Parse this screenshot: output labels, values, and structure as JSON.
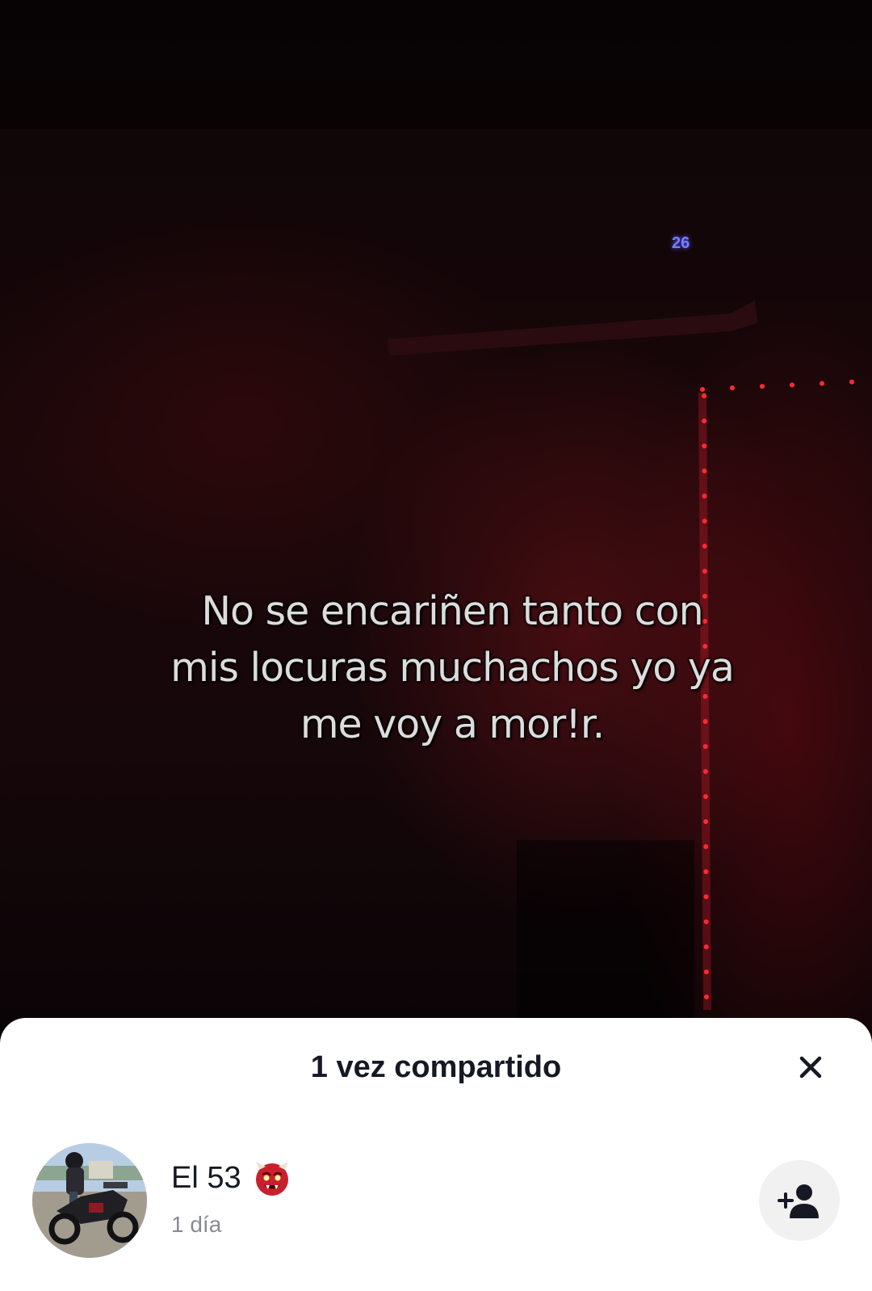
{
  "video": {
    "caption": "No se encariñen tanto con\nmis locuras muchachos yo ya\nme voy a mor!r.",
    "overlay_tag": "26"
  },
  "share_sheet": {
    "title": "1 vez compartido",
    "close_icon": "close-icon",
    "users": [
      {
        "name": "El 53",
        "badge_icon": "ogre-emoji-icon",
        "time": "1 día",
        "action_icon": "add-user-icon"
      }
    ]
  },
  "colors": {
    "sheet_bg": "#ffffff",
    "title_text": "#161823",
    "meta_text": "#8a8b91",
    "follow_button_bg": "#f1f1f2",
    "led_red": "#ff2a34"
  }
}
